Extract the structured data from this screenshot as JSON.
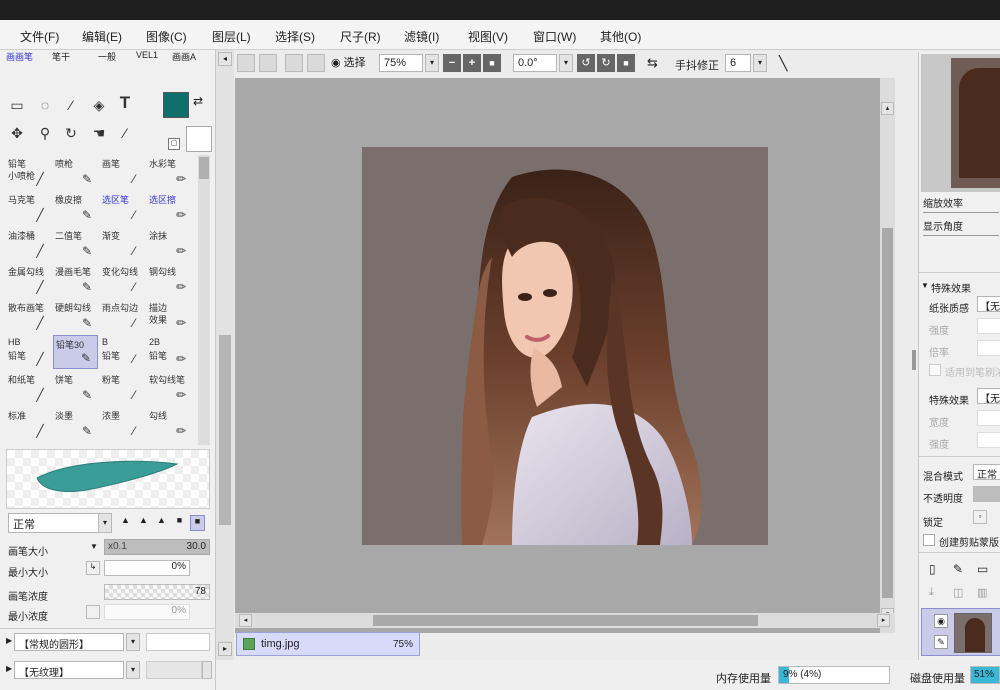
{
  "menu": [
    "文件(F)",
    "编辑(E)",
    "图像(C)",
    "图层(L)",
    "选择(S)",
    "尺子(R)",
    "滤镜(I)",
    "视图(V)",
    "窗口(W)",
    "其他(O)"
  ],
  "toolbar": {
    "selection_label": "选择",
    "zoom": "75%",
    "angle": "0.0°",
    "stabilizer_label": "手抖修正",
    "stabilizer_value": "6"
  },
  "left": {
    "tabs": [
      "画画笔",
      "笔干",
      "一般",
      "VEL1",
      "画画A"
    ],
    "color": "#0f6f6c",
    "brushes": [
      {
        "label": "铅笔",
        "sub": "小喷枪",
        "sel": false,
        "blue": false
      },
      {
        "label": "喷枪",
        "sub": "",
        "sel": false,
        "blue": false
      },
      {
        "label": "画笔",
        "sub": "",
        "sel": false,
        "blue": false
      },
      {
        "label": "水彩笔",
        "sub": "",
        "sel": false,
        "blue": false
      },
      {
        "label": "马克笔",
        "sub": "",
        "sel": false,
        "blue": false
      },
      {
        "label": "橡皮擦",
        "sub": "",
        "sel": false,
        "blue": false
      },
      {
        "label": "选区笔",
        "sub": "",
        "sel": false,
        "blue": true
      },
      {
        "label": "选区擦",
        "sub": "",
        "sel": false,
        "blue": true
      },
      {
        "label": "油漆桶",
        "sub": "",
        "sel": false,
        "blue": false
      },
      {
        "label": "二值笔",
        "sub": "",
        "sel": false,
        "blue": false
      },
      {
        "label": "渐变",
        "sub": "",
        "sel": false,
        "blue": false
      },
      {
        "label": "涂抹",
        "sub": "",
        "sel": false,
        "blue": false
      },
      {
        "label": "金属勾线",
        "sub": "",
        "sel": false,
        "blue": false
      },
      {
        "label": "漫画毛笔",
        "sub": "",
        "sel": false,
        "blue": false
      },
      {
        "label": "变化勾线",
        "sub": "",
        "sel": false,
        "blue": false
      },
      {
        "label": "钢勾线",
        "sub": "",
        "sel": false,
        "blue": false
      },
      {
        "label": "散布画笔",
        "sub": "",
        "sel": false,
        "blue": false
      },
      {
        "label": "硬朗勾线",
        "sub": "",
        "sel": false,
        "blue": false
      },
      {
        "label": "雨点勾边",
        "sub": "",
        "sel": false,
        "blue": false
      },
      {
        "label": "描边",
        "sub": "效果",
        "sel": false,
        "blue": false
      },
      {
        "label": "HB",
        "sub": "铅笔",
        "sel": false,
        "blue": false
      },
      {
        "label": "铅笔30",
        "sub": "",
        "sel": true,
        "blue": false
      },
      {
        "label": "B",
        "sub": "铅笔",
        "sel": false,
        "blue": false
      },
      {
        "label": "2B",
        "sub": "铅笔",
        "sel": false,
        "blue": false
      },
      {
        "label": "和纸笔",
        "sub": "",
        "sel": false,
        "blue": false
      },
      {
        "label": "饼笔",
        "sub": "",
        "sel": false,
        "blue": false
      },
      {
        "label": "粉笔",
        "sub": "",
        "sel": false,
        "blue": false
      },
      {
        "label": "软勾线笔",
        "sub": "",
        "sel": false,
        "blue": false
      },
      {
        "label": "标准",
        "sub": "",
        "sel": false,
        "blue": false
      },
      {
        "label": "淡墨",
        "sub": "",
        "sel": false,
        "blue": false
      },
      {
        "label": "浓墨",
        "sub": "",
        "sel": false,
        "blue": false
      },
      {
        "label": "勾线",
        "sub": "",
        "sel": false,
        "blue": false
      }
    ],
    "blend_mode": "正常",
    "size_label": "画笔大小",
    "size_multiplier": "x0.1",
    "size_value": "30.0",
    "min_size_label": "最小大小",
    "min_size_value": "0%",
    "density_label": "画笔浓度",
    "density_value": "78",
    "min_density_label": "最小浓度",
    "min_density_value": "0%",
    "shape_label": "【常规的圆形】",
    "texture_label": "【无纹理】"
  },
  "document": {
    "name": "timg.jpg",
    "zoom": "75%"
  },
  "status": {
    "memory_label": "内存使用量",
    "memory_value": "9% (4%)",
    "disk_label": "磁盘使用量",
    "disk_value": "51%"
  },
  "right": {
    "zoom_rate": "缩放效率",
    "display_angle": "显示角度",
    "special_effects": "特殊效果",
    "paper_texture": "纸张质感",
    "paper_value": "【无",
    "strength1": "强度",
    "magnification": "倍率",
    "apply_brush_density": "适用到笔刷浓",
    "special_label": "特殊效果",
    "special_value": "【无",
    "width_label": "宽度",
    "strength2": "强度",
    "blend_label": "混合模式",
    "blend_value": "正常",
    "opacity_label": "不透明度",
    "lock_label": "锁定",
    "clip_label": "创建剪贴蒙版"
  }
}
